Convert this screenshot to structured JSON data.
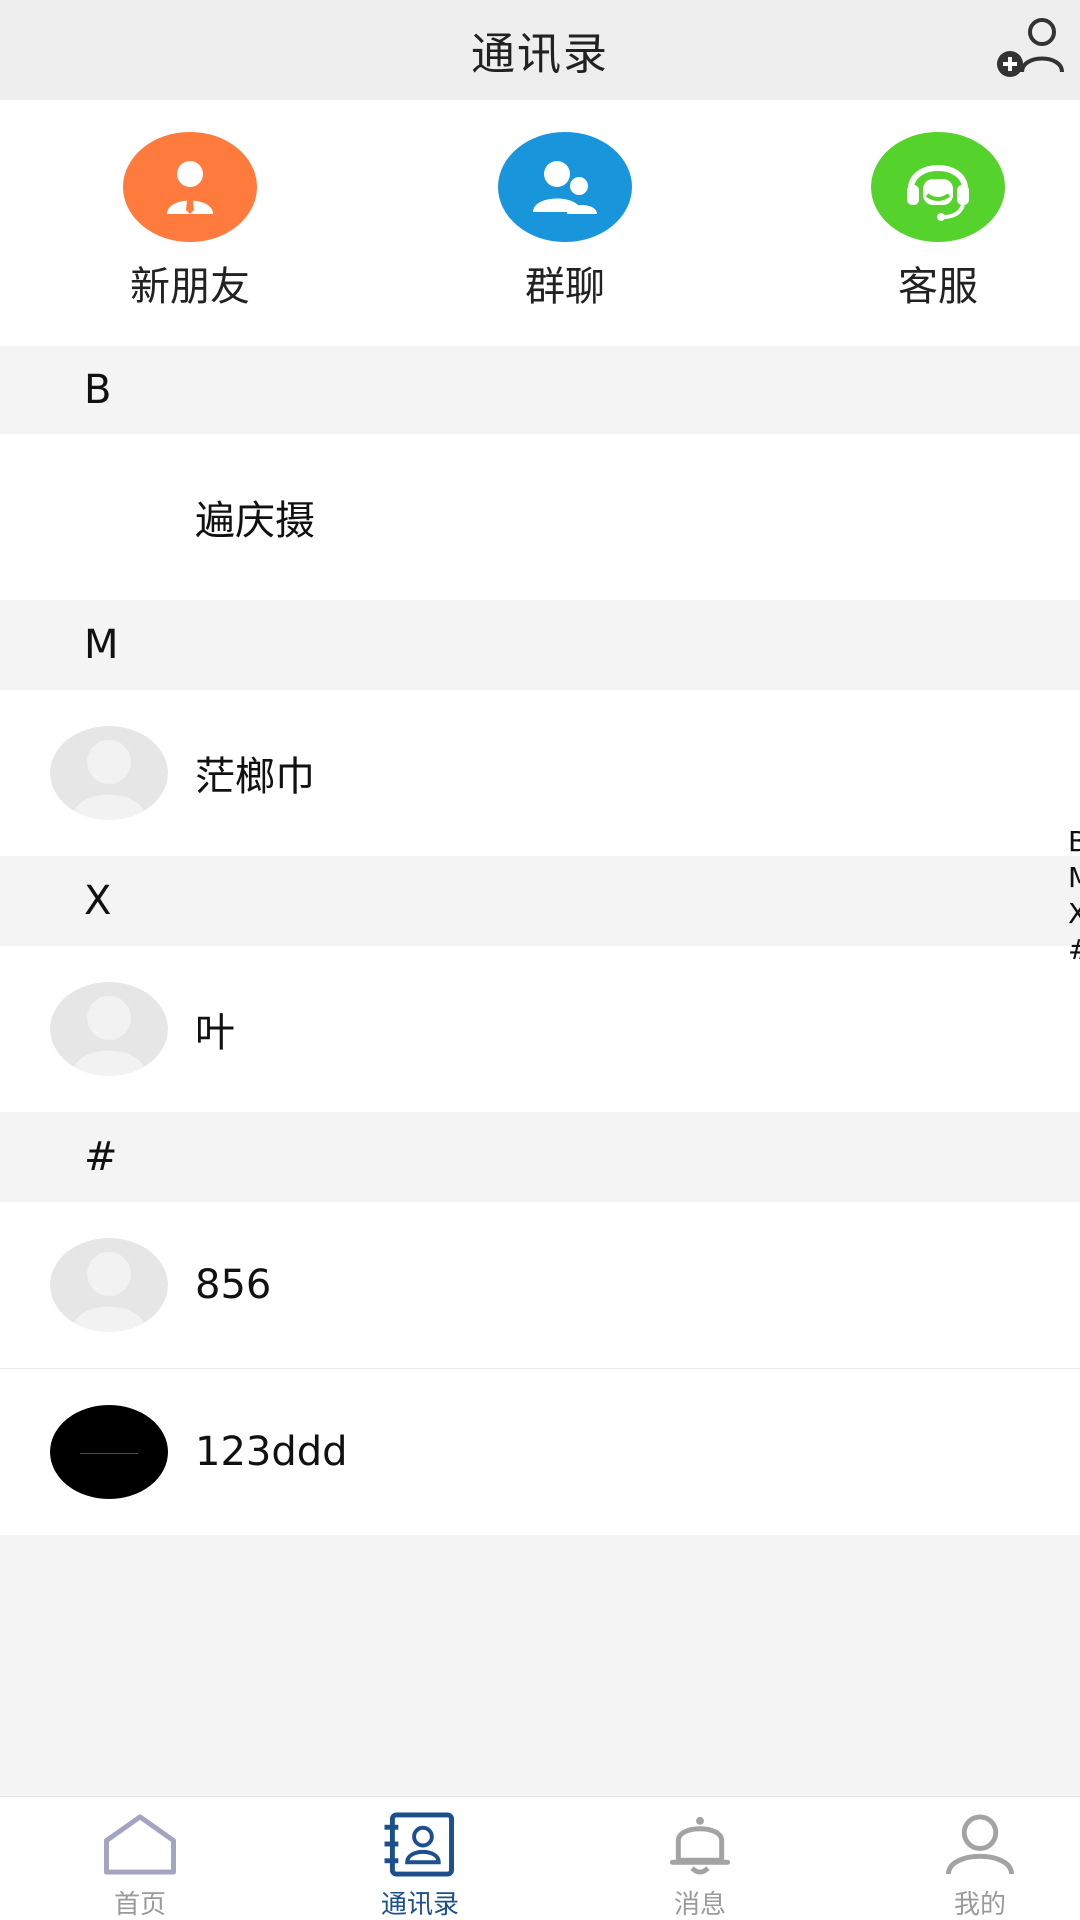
{
  "header": {
    "title": "通讯录"
  },
  "quick_actions": [
    {
      "label": "新朋友",
      "color": "#ff7a3c",
      "icon": "person-suit-icon"
    },
    {
      "label": "群聊",
      "color": "#1995dc",
      "icon": "people-icon"
    },
    {
      "label": "客服",
      "color": "#55d22b",
      "icon": "headset-icon"
    }
  ],
  "sections": [
    {
      "letter": "B",
      "contacts": [
        {
          "name": "遍庆摄",
          "avatar": "none"
        }
      ]
    },
    {
      "letter": "M",
      "contacts": [
        {
          "name": "茫榔巾",
          "avatar": "default"
        }
      ]
    },
    {
      "letter": "X",
      "contacts": [
        {
          "name": "叶",
          "avatar": "default"
        }
      ]
    },
    {
      "letter": "#",
      "contacts": [
        {
          "name": "856",
          "avatar": "default"
        },
        {
          "name": "123ddd",
          "avatar": "black"
        }
      ]
    }
  ],
  "index_bar": [
    "B",
    "M",
    "X",
    "#"
  ],
  "tabbar": {
    "tabs": [
      {
        "label": "首页",
        "icon": "home-icon",
        "active": false
      },
      {
        "label": "通讯录",
        "icon": "contacts-book-icon",
        "active": true
      },
      {
        "label": "消息",
        "icon": "bell-icon",
        "active": false
      },
      {
        "label": "我的",
        "icon": "person-icon",
        "active": false
      }
    ],
    "active_color": "#1b4f8e",
    "inactive_color": "#9a9a9a"
  }
}
